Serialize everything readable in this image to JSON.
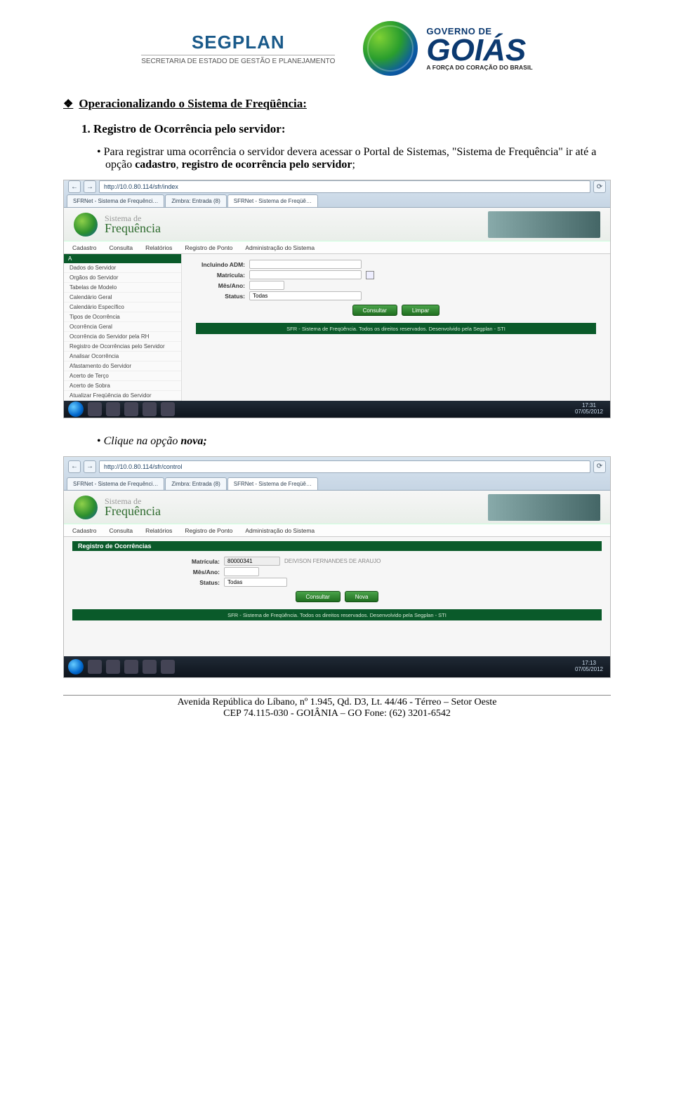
{
  "header": {
    "segplan_brand": "SEGPLAN",
    "segplan_tag": "SECRETARIA DE ESTADO DE GESTÃO E PLANEJAMENTO",
    "goias_top": "GOVERNO DE",
    "goias_main": "GOIÁS",
    "goias_slogan": "A FORÇA DO CORAÇÃO DO BRASIL"
  },
  "section_title": "Operacionalizando o Sistema de Freqüência:",
  "item1_title": "1. Registro de Ocorrência pelo servidor:",
  "bullet1": {
    "pre": "Para registrar uma ocorrência o servidor devera acessar o Portal de Sistemas, \"Sistema de Frequência\" ir até a opção ",
    "b1": "cadastro",
    "mid": ", ",
    "b2": "registro de ocorrência pelo servidor",
    "post": ";"
  },
  "bullet2": {
    "pre": "Clique na opção ",
    "b1": "nova;"
  },
  "screenshot1": {
    "url": "http://10.0.80.114/sfr/index",
    "tabs": [
      "SFRNet - Sistema de Frequênci…",
      "Zimbra: Entrada (8)",
      "SFRNet - Sistema de Freqüê…"
    ],
    "brand_lead": "Sistema de",
    "brand_main": "Frequência",
    "menubar": [
      "Cadastro",
      "Consulta",
      "Relatórios",
      "Registro de Ponto",
      "Administração do Sistema"
    ],
    "sidebar_header": "A",
    "sidebar_items": [
      "Dados do Servidor",
      "Orgãos do Servidor",
      "Tabelas de Modelo",
      "Calendário Geral",
      "Calendário Específico",
      "Tipos de Ocorrência",
      "Ocorrência Geral",
      "Ocorrência do Servidor pela RH",
      "Registro de Ocorrências pelo Servidor",
      "Analisar Ocorrência",
      "Afastamento do Servidor",
      "Acerto de Terço",
      "Acerto de Sobra",
      "Atualizar Freqüência do Servidor"
    ],
    "form": {
      "f1": "Incluindo ADM:",
      "f2": "Matrícula:",
      "f3": "Mês/Ano:",
      "f4": "Status:",
      "status_value": "Todas",
      "btn1": "Consultar",
      "btn2": "Limpar"
    },
    "footbar": "SFR - Sistema de Freqüência. Todos os direitos reservados. Desenvolvido pela Segplan - STI",
    "clock_time": "17:31",
    "clock_date": "07/05/2012"
  },
  "screenshot2": {
    "url": "http://10.0.80.114/sfr/control",
    "tabs": [
      "SFRNet - Sistema de Frequênci…",
      "Zimbra: Entrada (8)",
      "SFRNet - Sistema de Freqüê…"
    ],
    "brand_lead": "Sistema de",
    "brand_main": "Frequência",
    "menubar": [
      "Cadastro",
      "Consulta",
      "Relatórios",
      "Registro de Ponto",
      "Administração do Sistema"
    ],
    "panel_title": "Registro de Ocorrências",
    "form": {
      "f1": "Matrícula:",
      "f1_val": "80000341",
      "f1_name": "DEIVISON FERNANDES DE ARAUJO",
      "f2": "Mês/Ano:",
      "f3": "Status:",
      "status_value": "Todas",
      "btn1": "Consultar",
      "btn2": "Nova"
    },
    "footbar": "SFR - Sistema de Freqüência. Todos os direitos reservados. Desenvolvido pela Segplan - STI",
    "clock_time": "17:13",
    "clock_date": "07/05/2012"
  },
  "footer": {
    "line1": "Avenida República do Líbano, nº 1.945, Qd. D3, Lt. 44/46 - Térreo – Setor Oeste",
    "line2": "CEP 74.115-030 - GOIÂNIA – GO Fone: (62) 3201-6542"
  }
}
